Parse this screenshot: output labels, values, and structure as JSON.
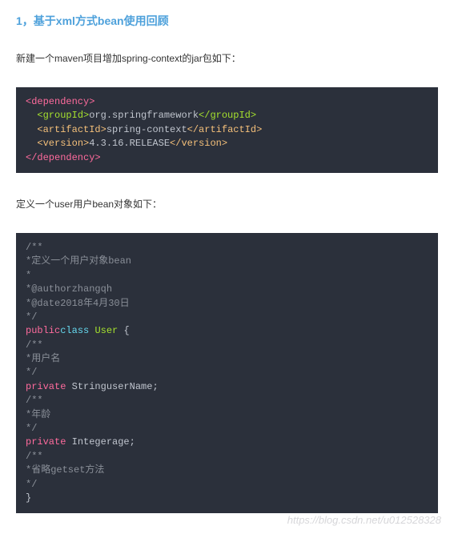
{
  "heading": "1，基于xml方式bean使用回顾",
  "para1": "新建一个maven项目增加spring-context的jar包如下：",
  "para2": "定义一个user用户bean对象如下：",
  "xml": {
    "dep_open": "<dependency>",
    "groupId_open": "<groupId>",
    "groupId_val": "org.springframework",
    "groupId_close": "</groupId>",
    "artifactId_open": "<artifactId>",
    "artifactId_val": "spring-context",
    "artifactId_close": "</artifactId>",
    "version_open": "<version>",
    "version_val": "4.3.16.RELEASE",
    "version_close": "</version>",
    "dep_close": "</dependency>"
  },
  "java": {
    "c_open": "/**",
    "c_star": "*",
    "c_close": "*/",
    "c_desc": "*定义一个用户对象bean",
    "c_author": "*@authorzhangqh",
    "c_date": "*@date2018年4月30日",
    "kw_public": "public",
    "kw_class": "class",
    "cls_name": "User",
    "brace_open": "{",
    "brace_close": "}",
    "c_username": "*用户名",
    "kw_private": "private",
    "field1": "StringuserName;",
    "c_age": "*年龄",
    "field2": "Integerage;",
    "c_skip": "*省略getset方法"
  },
  "watermark": "https://blog.csdn.net/u012528328"
}
